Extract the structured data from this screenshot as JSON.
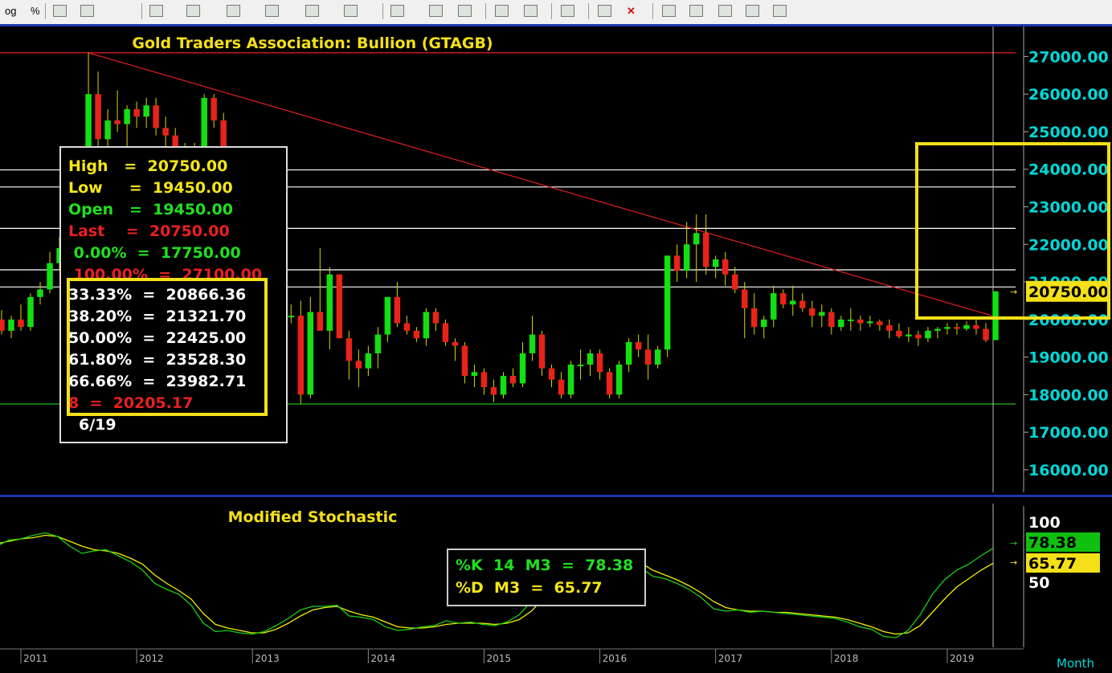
{
  "toolbar": {
    "log_label": "og",
    "pct_label": "%"
  },
  "colors": {
    "up": "#12e012",
    "down": "#e8231a",
    "axis": "#00d8d8",
    "trend": "#e02020",
    "fib": "#ffffff",
    "support": "#20d020",
    "k_line": "#18d018",
    "d_line": "#f0f000",
    "highlight": "#f3e018"
  },
  "chart_data": [
    {
      "type": "candlestick",
      "title": "Gold  Traders  Association:  Bullion  (GTAGB)",
      "ylim": [
        15400,
        27800
      ],
      "y_ticks": [
        "27000.00",
        "26000.00",
        "25000.00",
        "24000.00",
        "23000.00",
        "22000.00",
        "21000.00",
        "20000.00",
        "19000.00",
        "18000.00",
        "17000.00",
        "16000.00"
      ],
      "x_ticks": [
        "2011",
        "2012",
        "2013",
        "2014",
        "2015",
        "2016",
        "2017",
        "2018",
        "2019"
      ],
      "last_price_label": "20750.00",
      "horizontal_levels": [
        27100,
        17750,
        20866.36,
        21321.7,
        22425.0,
        23528.3,
        23982.71
      ],
      "trendline": {
        "from": [
          "2011-08",
          27100
        ],
        "to": [
          "2019-07",
          20000
        ]
      },
      "candles": [
        [
          "2010-09",
          19400,
          19600,
          19100,
          19200
        ],
        [
          "2010-10",
          19200,
          20200,
          19100,
          20000
        ],
        [
          "2010-11",
          20000,
          20250,
          19600,
          19700
        ],
        [
          "2010-12",
          19700,
          20100,
          19500,
          20000
        ],
        [
          "2011-01",
          20000,
          20400,
          19700,
          19800
        ],
        [
          "2011-02",
          19800,
          20700,
          19700,
          20600
        ],
        [
          "2011-03",
          20600,
          21000,
          20400,
          20800
        ],
        [
          "2011-04",
          20800,
          21800,
          20700,
          21500
        ],
        [
          "2011-05",
          21500,
          22200,
          21300,
          21900
        ],
        [
          "2011-06",
          21900,
          22200,
          21000,
          21200
        ],
        [
          "2011-07",
          21200,
          23300,
          21100,
          23100
        ],
        [
          "2011-08",
          23100,
          27100,
          22900,
          26000
        ],
        [
          "2011-09",
          26000,
          26600,
          24200,
          24800
        ],
        [
          "2011-10",
          24800,
          25600,
          24300,
          25300
        ],
        [
          "2011-11",
          25300,
          26100,
          25000,
          25200
        ],
        [
          "2011-12",
          25200,
          25700,
          24600,
          25600
        ],
        [
          "2012-01",
          25600,
          25800,
          25100,
          25400
        ],
        [
          "2012-02",
          25400,
          25900,
          25100,
          25700
        ],
        [
          "2012-03",
          25700,
          25900,
          24900,
          25100
        ],
        [
          "2012-04",
          25100,
          25400,
          24600,
          24900
        ],
        [
          "2012-05",
          24900,
          25100,
          23900,
          24200
        ],
        [
          "2012-06",
          24200,
          24700,
          23600,
          24100
        ],
        [
          "2012-07",
          24100,
          24700,
          23700,
          24500
        ],
        [
          "2012-08",
          24500,
          26000,
          24400,
          25900
        ],
        [
          "2012-09",
          25900,
          26000,
          25100,
          25300
        ],
        [
          "2012-10",
          25300,
          25500,
          23900,
          24100
        ],
        [
          "2012-11",
          24100,
          24400,
          23500,
          23800
        ],
        [
          "2012-12",
          23800,
          24200,
          22600,
          22800
        ],
        [
          "2013-01",
          22800,
          23100,
          21200,
          21600
        ],
        [
          "2013-02",
          21600,
          22000,
          20900,
          21200
        ],
        [
          "2013-03",
          21200,
          21600,
          20600,
          21000
        ],
        [
          "2013-04",
          21000,
          21200,
          19600,
          20100
        ],
        [
          "2013-05",
          20100,
          20400,
          19900,
          20100
        ],
        [
          "2013-06",
          20100,
          20500,
          17750,
          18000
        ],
        [
          "2013-07",
          18000,
          20600,
          17900,
          20200
        ],
        [
          "2013-08",
          20200,
          21900,
          20000,
          19700
        ],
        [
          "2013-09",
          19700,
          21400,
          19200,
          21200
        ],
        [
          "2013-10",
          21200,
          21200,
          19500,
          19500
        ],
        [
          "2013-11",
          19500,
          19700,
          18400,
          18900
        ],
        [
          "2013-12",
          18900,
          19200,
          18200,
          18700
        ],
        [
          "2014-01",
          18700,
          19300,
          18500,
          19100
        ],
        [
          "2014-02",
          19100,
          19800,
          18700,
          19600
        ],
        [
          "2014-03",
          19600,
          20600,
          19400,
          20600
        ],
        [
          "2014-04",
          20600,
          21000,
          19800,
          19900
        ],
        [
          "2014-05",
          19900,
          20100,
          19600,
          19700
        ],
        [
          "2014-06",
          19700,
          19800,
          19400,
          19500
        ],
        [
          "2014-07",
          19500,
          20300,
          19300,
          20200
        ],
        [
          "2014-08",
          20200,
          20300,
          19700,
          19900
        ],
        [
          "2014-09",
          19900,
          20000,
          19300,
          19400
        ],
        [
          "2014-10",
          19400,
          19500,
          18900,
          19300
        ],
        [
          "2014-11",
          19300,
          19400,
          18300,
          18500
        ],
        [
          "2014-12",
          18500,
          18800,
          18200,
          18600
        ],
        [
          "2015-01",
          18600,
          18700,
          18000,
          18200
        ],
        [
          "2015-02",
          18200,
          18400,
          17800,
          18000
        ],
        [
          "2015-03",
          18000,
          18600,
          17900,
          18500
        ],
        [
          "2015-04",
          18500,
          18700,
          18200,
          18300
        ],
        [
          "2015-05",
          18300,
          19400,
          18200,
          19100
        ],
        [
          "2015-06",
          19100,
          20100,
          18900,
          19600
        ],
        [
          "2015-07",
          19600,
          19700,
          18500,
          18700
        ],
        [
          "2015-08",
          18700,
          18800,
          18200,
          18400
        ],
        [
          "2015-09",
          18400,
          18600,
          17900,
          18000
        ],
        [
          "2015-10",
          18000,
          18900,
          17900,
          18800
        ],
        [
          "2015-11",
          18800,
          19200,
          18400,
          18800
        ],
        [
          "2015-12",
          18800,
          19200,
          18500,
          19100
        ],
        [
          "2016-01",
          19100,
          19200,
          18400,
          18600
        ],
        [
          "2016-02",
          18600,
          18700,
          17900,
          18000
        ],
        [
          "2016-03",
          18000,
          18900,
          17900,
          18800
        ],
        [
          "2016-04",
          18800,
          19500,
          18600,
          19400
        ],
        [
          "2016-05",
          19400,
          19600,
          19000,
          19200
        ],
        [
          "2016-06",
          19200,
          19600,
          18400,
          18800
        ],
        [
          "2016-07",
          18800,
          19300,
          18700,
          19200
        ],
        [
          "2016-08",
          19200,
          21700,
          19000,
          21700
        ],
        [
          "2016-09",
          21700,
          22000,
          21000,
          21300
        ],
        [
          "2016-10",
          21300,
          22600,
          21100,
          22000
        ],
        [
          "2016-11",
          22000,
          22800,
          21000,
          22300
        ],
        [
          "2016-12",
          22300,
          22800,
          21200,
          21400
        ],
        [
          "2017-01",
          21400,
          21700,
          21100,
          21600
        ],
        [
          "2017-02",
          21600,
          21800,
          20900,
          21200
        ],
        [
          "2017-03",
          21200,
          21400,
          20700,
          20800
        ],
        [
          "2017-04",
          20800,
          21000,
          19500,
          20300
        ],
        [
          "2017-05",
          20300,
          20700,
          19600,
          19800
        ],
        [
          "2017-06",
          19800,
          20100,
          19500,
          20000
        ],
        [
          "2017-07",
          20000,
          20900,
          19800,
          20700
        ],
        [
          "2017-08",
          20700,
          20800,
          20300,
          20400
        ],
        [
          "2017-09",
          20400,
          20900,
          20100,
          20500
        ],
        [
          "2017-10",
          20500,
          20700,
          20200,
          20300
        ],
        [
          "2017-11",
          20300,
          20500,
          19800,
          20100
        ],
        [
          "2017-12",
          20100,
          20400,
          19800,
          20200
        ],
        [
          "2018-01",
          20200,
          20300,
          19600,
          19800
        ],
        [
          "2018-02",
          19800,
          20100,
          19700,
          20000
        ],
        [
          "2018-03",
          20000,
          20300,
          19700,
          20000
        ],
        [
          "2018-04",
          20000,
          20100,
          19700,
          19900
        ],
        [
          "2018-05",
          19900,
          20100,
          19800,
          19950
        ],
        [
          "2018-06",
          19950,
          20000,
          19700,
          19850
        ],
        [
          "2018-07",
          19850,
          20000,
          19500,
          19700
        ],
        [
          "2018-08",
          19700,
          19900,
          19500,
          19550
        ],
        [
          "2018-09",
          19550,
          19800,
          19400,
          19600
        ],
        [
          "2018-10",
          19600,
          19700,
          19300,
          19500
        ],
        [
          "2018-11",
          19500,
          19800,
          19400,
          19700
        ],
        [
          "2018-12",
          19700,
          19800,
          19500,
          19750
        ],
        [
          "2019-01",
          19750,
          19900,
          19600,
          19800
        ],
        [
          "2019-02",
          19800,
          19900,
          19600,
          19750
        ],
        [
          "2019-03",
          19750,
          19950,
          19700,
          19850
        ],
        [
          "2019-04",
          19850,
          20000,
          19600,
          19750
        ],
        [
          "2019-05",
          19750,
          19900,
          19400,
          19450
        ],
        [
          "2019-06",
          19450,
          20750,
          19450,
          20750
        ]
      ],
      "data_box": [
        [
          "High   =  20750.00",
          "#f5e617"
        ],
        [
          "Low     =  19450.00",
          "#f5e617"
        ],
        [
          "Open   =  19450.00",
          "#20e020"
        ],
        [
          "Last    =  20750.00",
          "#e82020"
        ],
        [
          " 0.00%  =  17750.00",
          "#20e020"
        ],
        [
          " 100.00%  =  27100.00",
          "#e82020"
        ],
        [
          "33.33%  =  20866.36",
          "#ffffff"
        ],
        [
          "38.20%  =  21321.70",
          "#ffffff"
        ],
        [
          "50.00%  =  22425.00",
          "#ffffff"
        ],
        [
          "61.80%  =  23528.30",
          "#ffffff"
        ],
        [
          "66.66%  =  23982.71",
          "#ffffff"
        ],
        [
          "8  =  20205.17",
          "#e82020"
        ],
        [
          "6/19",
          "#ffffff"
        ]
      ]
    },
    {
      "type": "line",
      "title": "Modified  Stochastic",
      "ylim": [
        0,
        100
      ],
      "y_ticks": [
        "100",
        "50"
      ],
      "k_label": "78.38",
      "d_label": "65.77",
      "legend": [
        "%K  14  M3  =  78.38",
        "%D  M3  =  65.77"
      ],
      "series": [
        {
          "name": "%K  14  M3",
          "values": [
            80,
            85,
            86,
            89,
            91,
            88,
            80,
            74,
            76,
            77,
            72,
            67,
            60,
            49,
            44,
            40,
            31,
            16,
            9,
            10,
            8,
            7,
            9,
            14,
            20,
            27,
            30,
            30,
            31,
            22,
            21,
            19,
            13,
            10,
            11,
            13,
            14,
            18,
            16,
            17,
            15,
            14,
            17,
            23,
            34,
            47,
            58,
            65,
            70,
            73,
            74,
            74,
            69,
            62,
            55,
            53,
            49,
            44,
            37,
            28,
            26,
            27,
            25,
            26,
            25,
            24,
            23,
            22,
            21,
            20,
            17,
            13,
            11,
            5,
            4,
            10,
            23,
            40,
            52,
            60,
            65,
            72,
            78.38
          ]
        },
        {
          "name": "%D  M3",
          "values": [
            82,
            84,
            86,
            87,
            89,
            88,
            84,
            80,
            77,
            76,
            74,
            70,
            65,
            56,
            49,
            43,
            36,
            24,
            15,
            12,
            10,
            8,
            8,
            11,
            16,
            22,
            27,
            29,
            30,
            26,
            23,
            21,
            17,
            13,
            12,
            12,
            13,
            15,
            16,
            16,
            16,
            15,
            16,
            19,
            26,
            37,
            48,
            58,
            65,
            70,
            73,
            73,
            71,
            66,
            60,
            56,
            52,
            47,
            41,
            34,
            29,
            27,
            26,
            26,
            25,
            25,
            24,
            23,
            22,
            21,
            19,
            16,
            13,
            9,
            7,
            8,
            14,
            25,
            36,
            46,
            53,
            60,
            65.77
          ]
        }
      ],
      "x_ticks": [
        "2011",
        "2012",
        "2013",
        "2014",
        "2015",
        "2016",
        "2017",
        "2018",
        "2019"
      ],
      "period_label": "Month"
    }
  ]
}
